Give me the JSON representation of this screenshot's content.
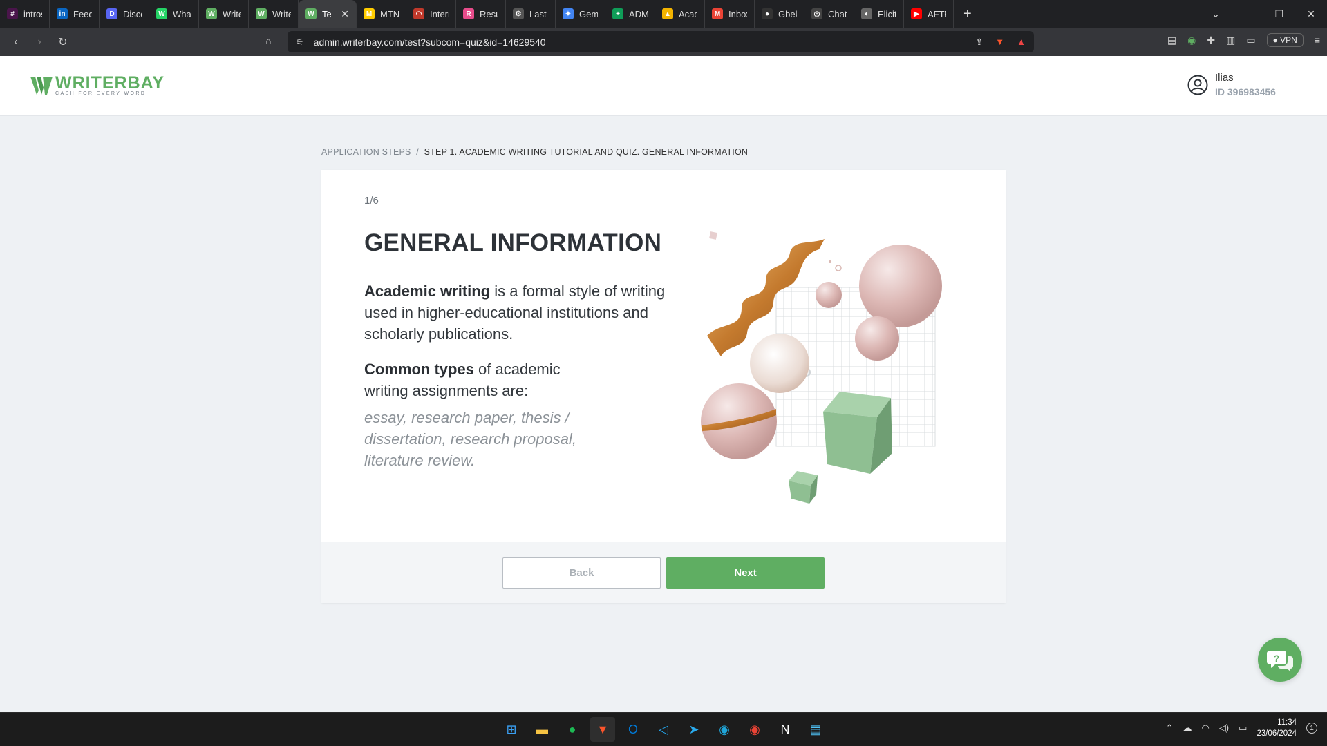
{
  "browser": {
    "tabs": [
      {
        "label": "intros (C",
        "icon": "slack-icon",
        "color": "#4a154b",
        "glyph": "#"
      },
      {
        "label": "Feed | Li",
        "icon": "linkedin-icon",
        "color": "#0a66c2",
        "glyph": "in"
      },
      {
        "label": "Discord",
        "icon": "discord-icon",
        "color": "#5865f2",
        "glyph": "D"
      },
      {
        "label": "WhatsAp",
        "icon": "whatsapp-icon",
        "color": "#25d366",
        "glyph": "W"
      },
      {
        "label": "WriterBa",
        "icon": "writerbay-icon",
        "color": "#5fae62",
        "glyph": "W"
      },
      {
        "label": "WriterBa",
        "icon": "writerbay-icon",
        "color": "#5fae62",
        "glyph": "W"
      },
      {
        "label": "Test",
        "icon": "writerbay-icon",
        "color": "#5fae62",
        "glyph": "W",
        "active": true
      },
      {
        "label": "MTN Mo",
        "icon": "mtn-icon",
        "color": "#ffcc00",
        "glyph": "M"
      },
      {
        "label": "Internet",
        "icon": "internet-icon",
        "color": "#c0392b",
        "glyph": "◠"
      },
      {
        "label": "Resume",
        "icon": "resume-icon",
        "color": "#e74c8b",
        "glyph": "R"
      },
      {
        "label": "Last nar",
        "icon": "gear-icon",
        "color": "#555555",
        "glyph": "⚙"
      },
      {
        "label": "Gemini",
        "icon": "gemini-icon",
        "color": "#4285f4",
        "glyph": "✦"
      },
      {
        "label": "ADMISS",
        "icon": "sheets-icon",
        "color": "#0f9d58",
        "glyph": "+"
      },
      {
        "label": "Academ",
        "icon": "drive-icon",
        "color": "#f4b400",
        "glyph": "▲"
      },
      {
        "label": "Inbox -",
        "icon": "gmail-icon",
        "color": "#ea4335",
        "glyph": "M"
      },
      {
        "label": "Gbekoil",
        "icon": "github-icon",
        "color": "#333333",
        "glyph": "●"
      },
      {
        "label": "ChatGP",
        "icon": "chatgpt-icon",
        "color": "#444444",
        "glyph": "◎"
      },
      {
        "label": "Elicit: Th",
        "icon": "elicit-icon",
        "color": "#666666",
        "glyph": "◐"
      },
      {
        "label": "AFTER S",
        "icon": "youtube-icon",
        "color": "#ff0000",
        "glyph": "▶"
      }
    ],
    "new_tab": "+",
    "url": "admin.writerbay.com/test?subcom=quiz&id=14629540",
    "vpn_label": "VPN"
  },
  "header": {
    "logo_name": "WRITERBAY",
    "logo_tagline": "CASH FOR EVERY WORD",
    "user_name": "Ilias",
    "user_id": "ID 396983456"
  },
  "breadcrumb": {
    "root": "APPLICATION STEPS",
    "separator": "/",
    "current": "STEP 1. ACADEMIC WRITING TUTORIAL AND QUIZ. GENERAL INFORMATION"
  },
  "card": {
    "step_counter": "1/6",
    "title": "GENERAL INFORMATION",
    "p1_bold": "Academic writing",
    "p1_rest": " is a formal style of writing used in higher-educational institutions and scholarly publications.",
    "p2_bold": "Common types",
    "p2_rest": " of academic writing assignments are:",
    "p3": "essay, research paper, thesis / dissertation, research proposal, literature review."
  },
  "actions": {
    "back_label": "Back",
    "next_label": "Next"
  },
  "taskbar": {
    "apps": [
      {
        "name": "windows-start-icon",
        "glyph": "⊞",
        "color": "#3aa0f3"
      },
      {
        "name": "file-explorer-icon",
        "glyph": "▬",
        "color": "#f6c343"
      },
      {
        "name": "spotify-icon",
        "glyph": "●",
        "color": "#1db954"
      },
      {
        "name": "brave-icon",
        "glyph": "▼",
        "color": "#fb542b"
      },
      {
        "name": "outlook-icon",
        "glyph": "O",
        "color": "#0078d4"
      },
      {
        "name": "vscode-icon",
        "glyph": "◁",
        "color": "#23a9f2"
      },
      {
        "name": "telegram-icon",
        "glyph": "➤",
        "color": "#2aabee"
      },
      {
        "name": "edge-icon",
        "glyph": "◉",
        "color": "#1fa5d8"
      },
      {
        "name": "chrome-icon",
        "glyph": "◉",
        "color": "#ea4335"
      },
      {
        "name": "notion-icon",
        "glyph": "N",
        "color": "#ffffff"
      },
      {
        "name": "notepad-icon",
        "glyph": "▤",
        "color": "#4fc3f7"
      }
    ],
    "time": "11:34",
    "date": "23/06/2024",
    "notification_count": "1"
  },
  "colors": {
    "brand_green": "#5fae62",
    "page_bg": "#eef1f4"
  }
}
